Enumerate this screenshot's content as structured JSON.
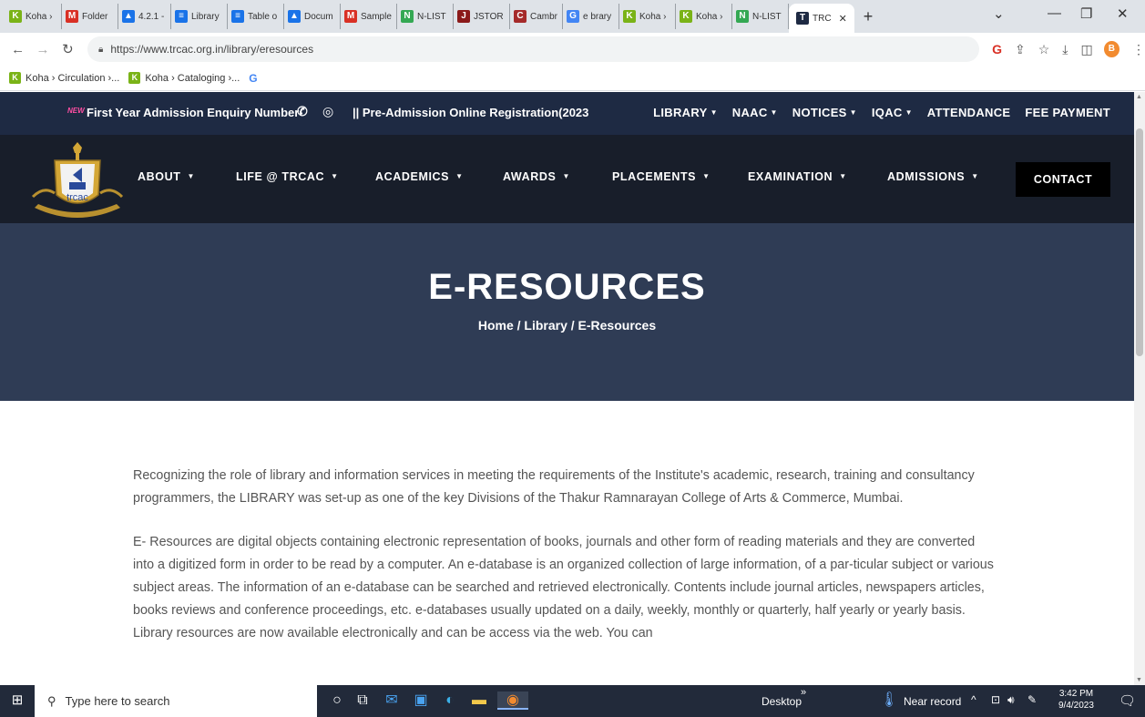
{
  "browser": {
    "tabs": [
      {
        "label": "Koha ›",
        "fav": "K",
        "color": "#7ab317"
      },
      {
        "label": "Folder",
        "fav": "M",
        "color": "#d93025"
      },
      {
        "label": "4.2.1 - ",
        "fav": "▲",
        "color": "#1a73e8"
      },
      {
        "label": "Library",
        "fav": "≡",
        "color": "#1a73e8"
      },
      {
        "label": "Table o",
        "fav": "≡",
        "color": "#1a73e8"
      },
      {
        "label": "Docum",
        "fav": "▲",
        "color": "#1a73e8"
      },
      {
        "label": "Sample",
        "fav": "M",
        "color": "#d93025"
      },
      {
        "label": "N-LIST",
        "fav": "N",
        "color": "#34a853"
      },
      {
        "label": "JSTOR",
        "fav": "J",
        "color": "#8b1a1a"
      },
      {
        "label": "Cambr",
        "fav": "C",
        "color": "#a52a2a"
      },
      {
        "label": "e brary",
        "fav": "G",
        "color": "#4285f4"
      },
      {
        "label": "Koha ›",
        "fav": "K",
        "color": "#7ab317"
      },
      {
        "label": "Koha ›",
        "fav": "K",
        "color": "#7ab317"
      },
      {
        "label": "N-LIST",
        "fav": "N",
        "color": "#34a853"
      }
    ],
    "active_tab": {
      "label": "TRC",
      "fav": "T"
    },
    "url": "https://www.trcac.org.in/library/eresources",
    "profile_initial": "B",
    "bookmarks": [
      "Koha › Circulation ›...",
      "Koha › Cataloging ›..."
    ]
  },
  "site": {
    "topbar": {
      "new_badge": "NEW",
      "enquiry": "First Year Admission Enquiry Number",
      "prereg": "|| Pre-Admission Online Registration(2023",
      "links": [
        "LIBRARY",
        "NAAC",
        "NOTICES",
        "IQAC",
        "ATTENDANCE",
        "FEE PAYMENT"
      ],
      "links_with_caret": [
        true,
        true,
        true,
        true,
        false,
        false
      ]
    },
    "logo_text": "trcac",
    "nav": [
      "ABOUT",
      "LIFE @ TRCAC",
      "ACADEMICS",
      "AWARDS",
      "PLACEMENTS",
      "EXAMINATION",
      "ADMISSIONS"
    ],
    "contact": "CONTACT",
    "hero": {
      "title": "E-RESOURCES",
      "breadcrumb": "Home / Library / E-Resources"
    },
    "content": {
      "p1": "Recognizing the role of library and information services in meeting the requirements of the Institute's academic, research, training and consultancy programmers, the LIBRARY was set-up as one of the key Divisions of the Thakur Ramnarayan College of Arts & Commerce, Mumbai.",
      "p2": "E- Resources are digital objects containing electronic representation of books, journals and other form of reading materials and they are converted into a digitized form in order to be read by a computer. An e-database is an organized collection of large information, of a par-ticular subject or various subject areas. The information of an e-database can be searched and retrieved electronically. Contents include journal articles, newspapers articles, books reviews and conference proceedings, etc. e-databases usually updated on a daily, weekly, monthly or quarterly, half yearly or yearly basis. Library resources are now available electronically and can be access via the web. You can"
    }
  },
  "taskbar": {
    "search_placeholder": "Type here to search",
    "desktop": "Desktop",
    "weather": "Near record",
    "time": "3:42 PM",
    "date": "9/4/2023"
  }
}
